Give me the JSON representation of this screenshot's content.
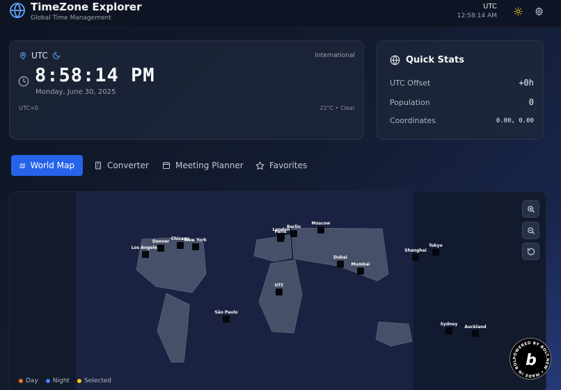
{
  "header": {
    "title": "TimeZone Explorer",
    "subtitle": "Global Time Management",
    "timezone": "UTC",
    "time": "12:58:14 AM"
  },
  "clock": {
    "location": "UTC",
    "region": "International",
    "time": "8:58:14 PM",
    "date": "Monday, June 30, 2025",
    "offset": "UTC+0",
    "weather": "22°C • Clear"
  },
  "stats": {
    "title": "Quick Stats",
    "rows": [
      {
        "label": "UTC Offset",
        "value": "+0h"
      },
      {
        "label": "Population",
        "value": "0"
      },
      {
        "label": "Coordinates",
        "value": "0.00, 0.00"
      }
    ]
  },
  "tabs": [
    {
      "label": "World Map",
      "icon": "map-icon",
      "active": true
    },
    {
      "label": "Converter",
      "icon": "calculator-icon",
      "active": false
    },
    {
      "label": "Meeting Planner",
      "icon": "calendar-icon",
      "active": false
    },
    {
      "label": "Favorites",
      "icon": "star-icon",
      "active": false
    }
  ],
  "cities": [
    {
      "name": "Los Angeles"
    },
    {
      "name": "Denver"
    },
    {
      "name": "Chicago"
    },
    {
      "name": "New York"
    },
    {
      "name": "London"
    },
    {
      "name": "Paris"
    },
    {
      "name": "Berlin"
    },
    {
      "name": "Moscow"
    },
    {
      "name": "Dubai"
    },
    {
      "name": "Mumbai"
    },
    {
      "name": "Shanghai"
    },
    {
      "name": "Tokyo"
    },
    {
      "name": "UTC"
    },
    {
      "name": "São Paulo"
    },
    {
      "name": "Sydney"
    },
    {
      "name": "Auckland"
    }
  ],
  "legend": [
    {
      "label": "Day",
      "color": "#f97316"
    },
    {
      "label": "Night",
      "color": "#3b82f6"
    },
    {
      "label": "Selected",
      "color": "#facc15"
    }
  ],
  "colors": {
    "accent": "#2563eb",
    "icon_blue": "#60a5fa"
  },
  "badge": {
    "text": "POWERED BY BOLT.NEW • MADE IN BOLT.NEW •",
    "letter": "b"
  }
}
